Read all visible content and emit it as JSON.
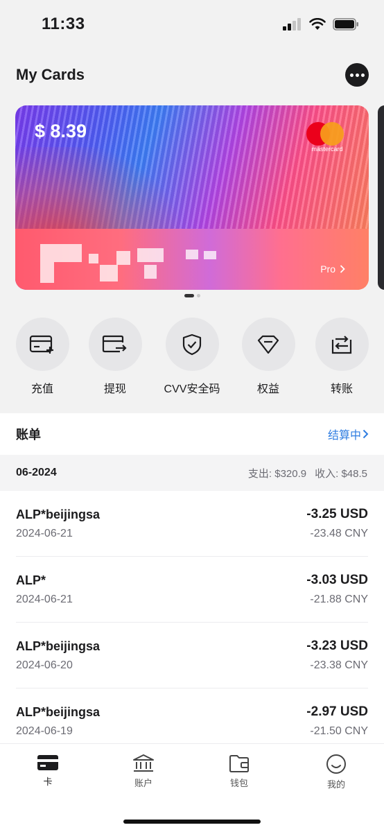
{
  "status_bar": {
    "time": "11:33"
  },
  "header": {
    "title": "My Cards"
  },
  "card": {
    "balance": "$ 8.39",
    "network": "mastercard",
    "tier": "Pro",
    "next_icon": "chevron-right-icon"
  },
  "actions": [
    {
      "label": "充值",
      "icon": "card-plus-icon"
    },
    {
      "label": "提现",
      "icon": "card-withdraw-icon"
    },
    {
      "label": "CVV安全码",
      "icon": "shield-check-icon"
    },
    {
      "label": "权益",
      "icon": "diamond-icon"
    },
    {
      "label": "转账",
      "icon": "transfer-icon"
    }
  ],
  "bills": {
    "title": "账单",
    "status": "结算中",
    "month": "06-2024",
    "expense": "支出: $320.9",
    "income": "收入: $48.5",
    "transactions": [
      {
        "merchant": "ALP*beijingsa",
        "date": "2024-06-21",
        "amount": "-3.25 USD",
        "cny": "-23.48 CNY"
      },
      {
        "merchant": "ALP*",
        "date": "2024-06-21",
        "amount": "-3.03 USD",
        "cny": "-21.88 CNY"
      },
      {
        "merchant": "ALP*beijingsa",
        "date": "2024-06-20",
        "amount": "-3.23 USD",
        "cny": "-23.38 CNY"
      },
      {
        "merchant": "ALP*beijingsa",
        "date": "2024-06-19",
        "amount": "-2.97 USD",
        "cny": "-21.50 CNY"
      }
    ]
  },
  "tabs": [
    {
      "label": "卡",
      "icon": "card-icon",
      "active": true
    },
    {
      "label": "账户",
      "icon": "bank-icon",
      "active": false
    },
    {
      "label": "钱包",
      "icon": "wallet-icon",
      "active": false
    },
    {
      "label": "我的",
      "icon": "smiley-icon",
      "active": false
    }
  ],
  "colors": {
    "accent": "#2f7de1",
    "text": "#1c1c1e",
    "muted": "#6b6b73"
  }
}
